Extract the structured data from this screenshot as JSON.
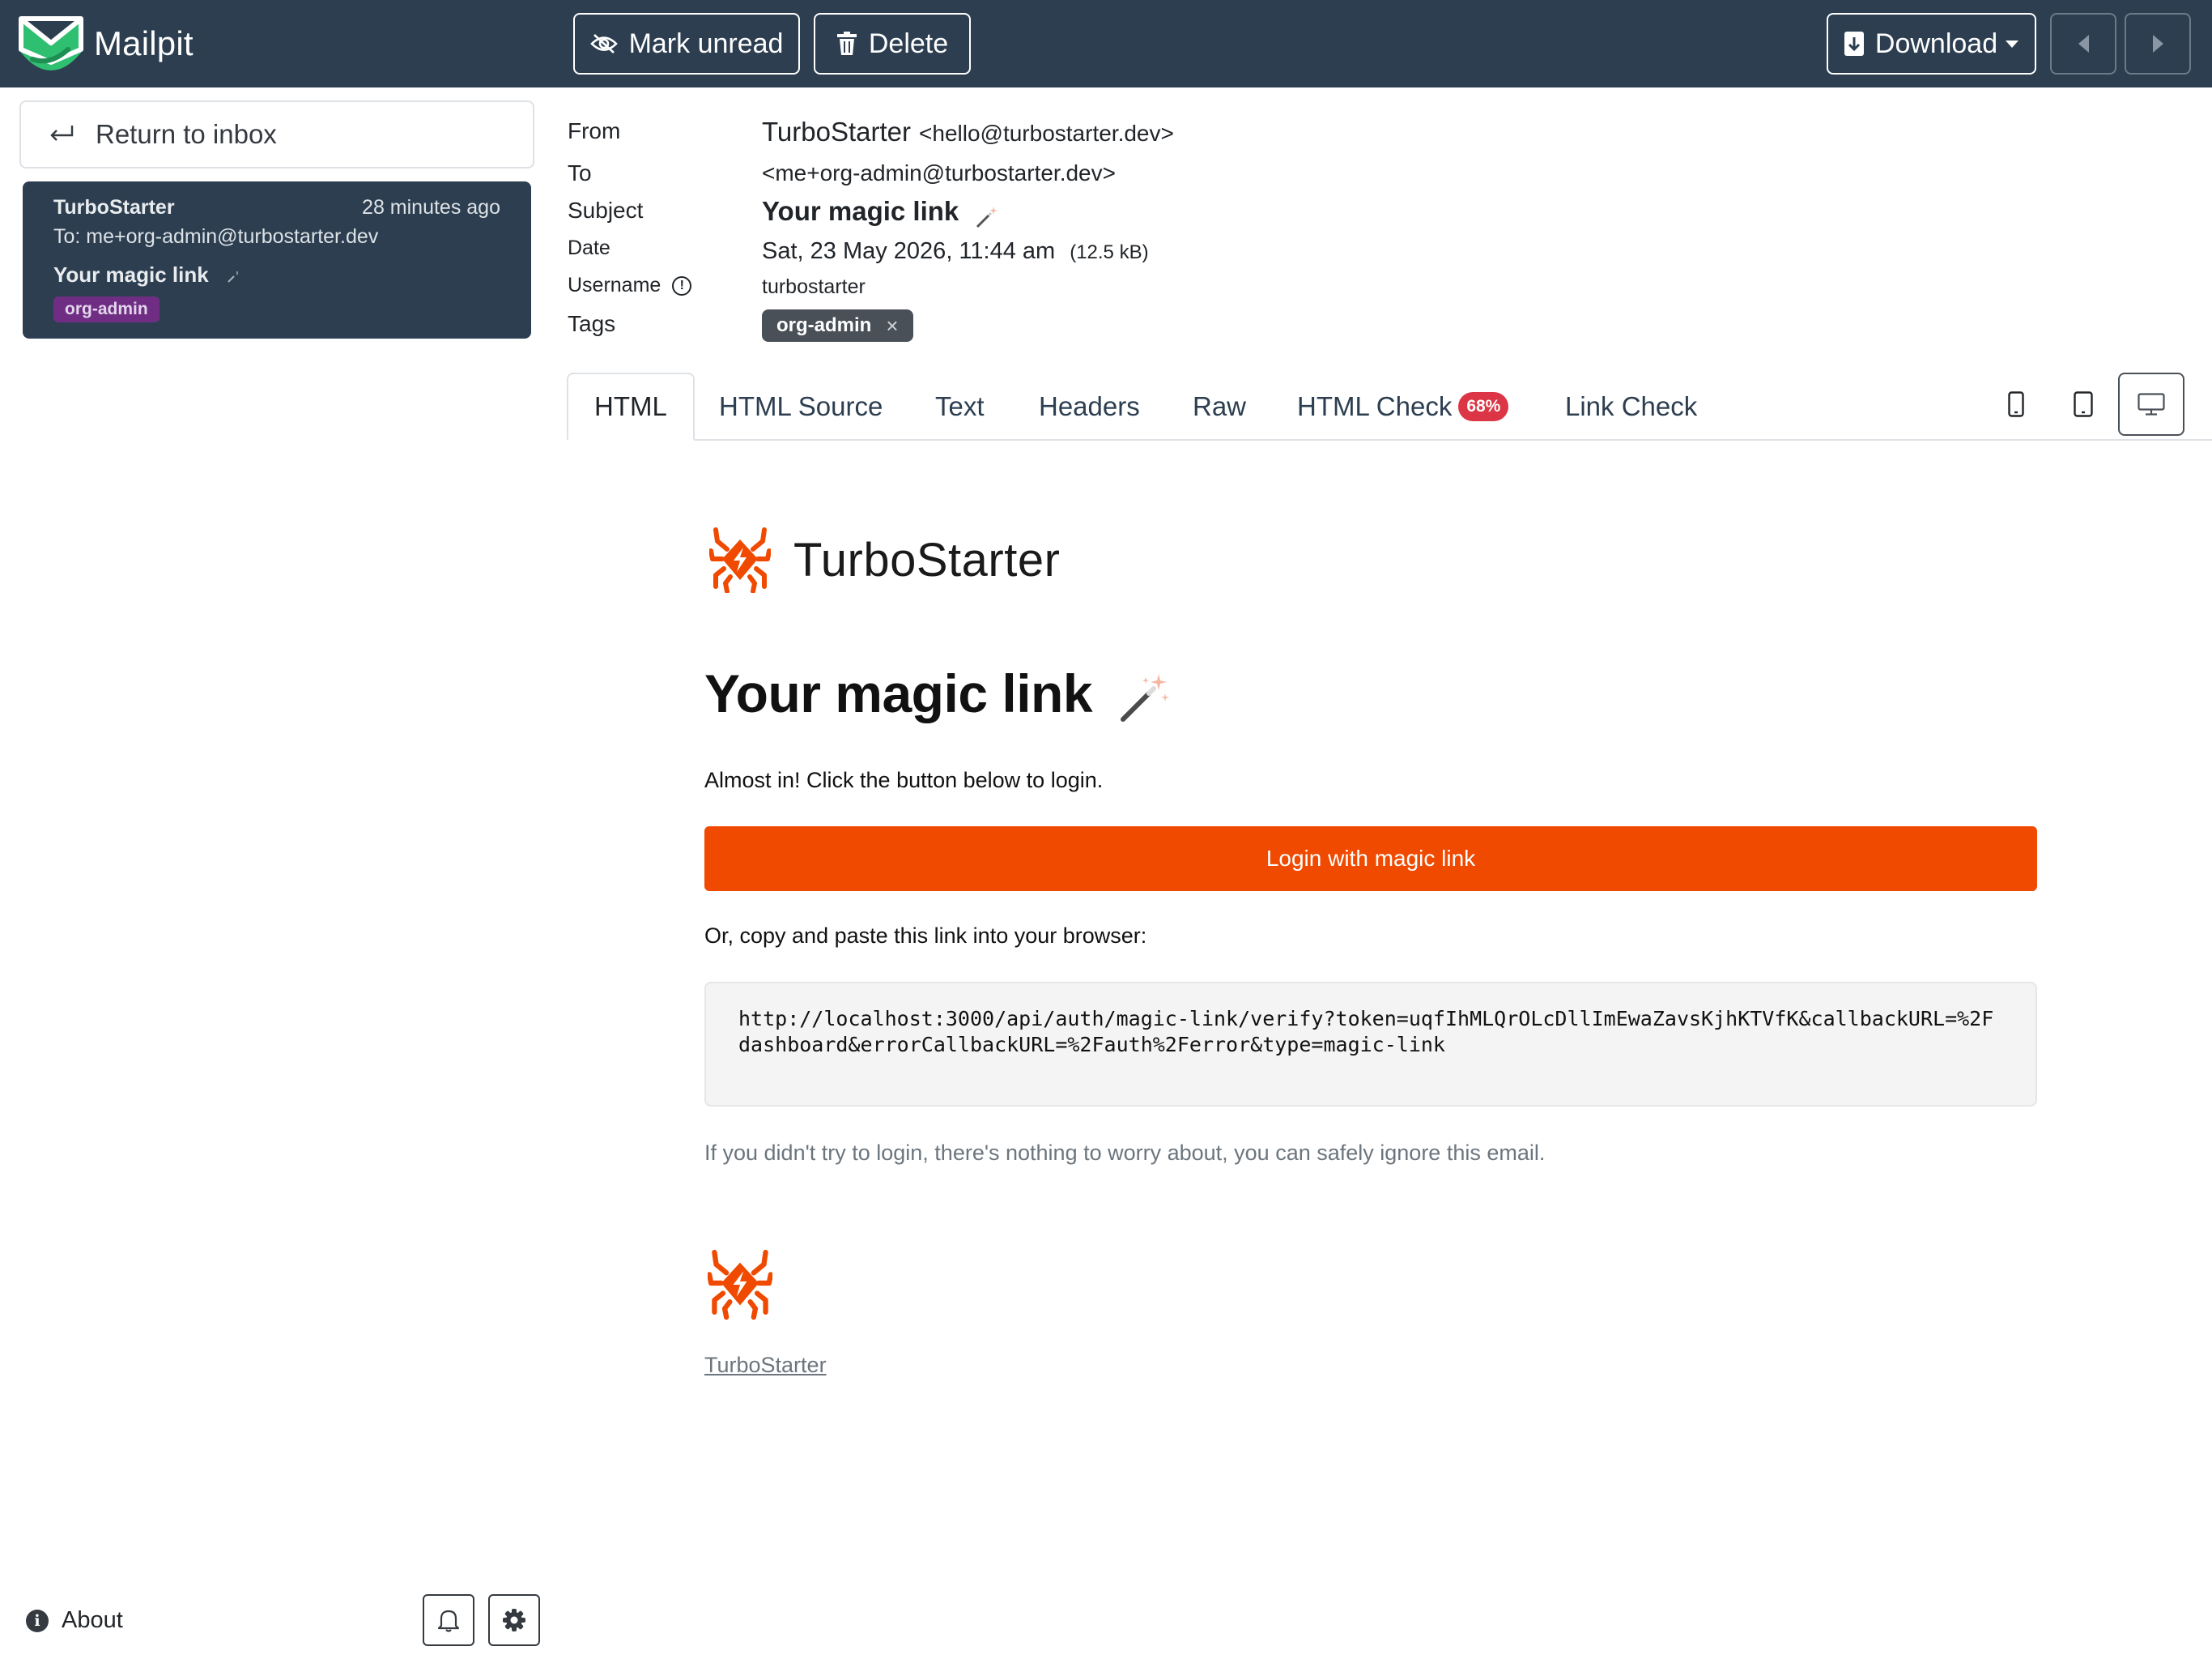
{
  "app": {
    "name": "Mailpit",
    "colors": {
      "topbar": "#2c3e50",
      "accent": "#f04a00",
      "badge_red": "#dc3545",
      "tag_purple": "#6f2e84"
    }
  },
  "toolbar": {
    "mark_unread_label": "Mark unread",
    "delete_label": "Delete",
    "download_label": "Download"
  },
  "sidebar": {
    "return_label": "Return to inbox",
    "message": {
      "from": "TurboStarter",
      "time": "28 minutes ago",
      "to": "To: me+org-admin@turbostarter.dev",
      "subject": "Your magic link",
      "tag": "org-admin"
    },
    "about_label": "About"
  },
  "headers": {
    "from_label": "From",
    "from_name": "TurboStarter",
    "from_address": "<hello@turbostarter.dev>",
    "to_label": "To",
    "to_value": "<me+org-admin@turbostarter.dev>",
    "subject_label": "Subject",
    "subject_value": "Your magic link",
    "date_label": "Date",
    "date_value": "Sat, 23 May 2026, 11:44 am",
    "size": "(12.5 kB)",
    "username_label": "Username",
    "username_value": "turbostarter",
    "tags_label": "Tags",
    "tag": "org-admin",
    "tag_remove": "×"
  },
  "tabs": {
    "html": "HTML",
    "html_source": "HTML Source",
    "text": "Text",
    "headers": "Headers",
    "raw": "Raw",
    "html_check": "HTML Check",
    "html_check_score": "68%",
    "link_check": "Link Check"
  },
  "email": {
    "brand": "TurboStarter",
    "heading": "Your magic link",
    "intro": "Almost in! Click the button below to login.",
    "button": "Login with magic link",
    "copy_hint": "Or, copy and paste this link into your browser:",
    "link": "http://localhost:3000/api/auth/magic-link/verify?token=uqfIhMLQrOLcDllImEwaZavsKjhKTVfK&callbackURL=%2Fdashboard&errorCallbackURL=%2Fauth%2Ferror&type=magic-link",
    "ignore": "If you didn't try to login, there's nothing to worry about, you can safely ignore this email.",
    "footer_link": "TurboStarter"
  }
}
